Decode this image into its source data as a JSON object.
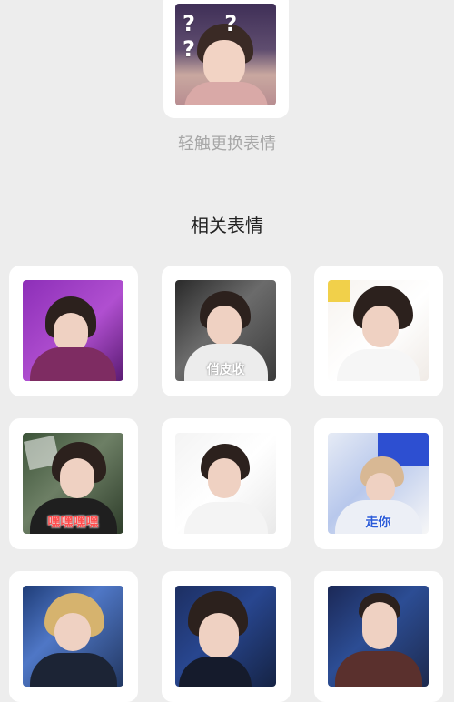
{
  "current_sticker": {
    "overlay_text": "? ? ?"
  },
  "hint": {
    "text": "轻触更换表情"
  },
  "related": {
    "title": "相关表情",
    "items": [
      {
        "icon": "sticker-thumbnail"
      },
      {
        "icon": "sticker-thumbnail",
        "caption": "俏皮收"
      },
      {
        "icon": "sticker-thumbnail"
      },
      {
        "icon": "sticker-thumbnail",
        "caption": "嘿嘿嘿嘿"
      },
      {
        "icon": "sticker-thumbnail"
      },
      {
        "icon": "sticker-thumbnail",
        "caption": "走你"
      },
      {
        "icon": "sticker-thumbnail"
      },
      {
        "icon": "sticker-thumbnail"
      },
      {
        "icon": "sticker-thumbnail"
      }
    ]
  },
  "colors": {
    "page_background": "#ededed",
    "card_background": "#ffffff",
    "hint_text": "#a7a7a7",
    "title_text": "#222222",
    "divider": "#d5d5d5"
  }
}
